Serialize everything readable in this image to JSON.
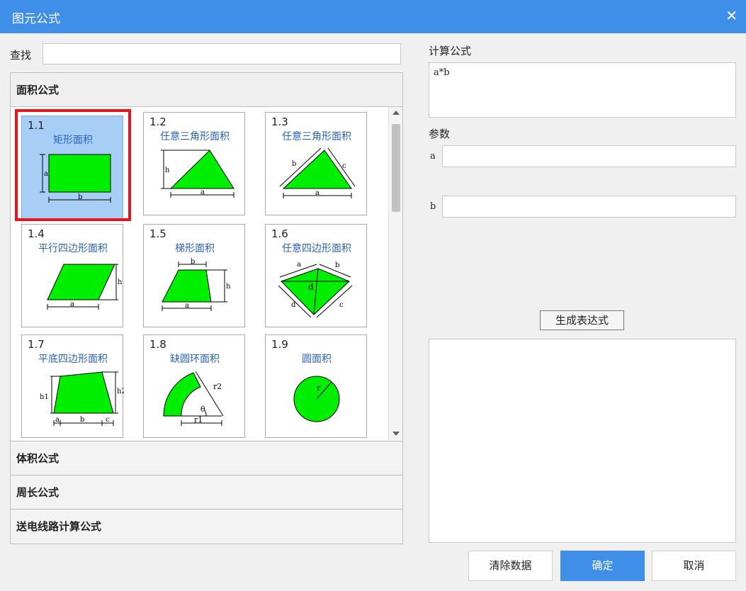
{
  "window": {
    "title": "图元公式"
  },
  "search": {
    "label": "查找",
    "value": ""
  },
  "groups": [
    {
      "label": "面积公式"
    },
    {
      "label": "体积公式"
    },
    {
      "label": "周长公式"
    },
    {
      "label": "送电线路计算公式"
    }
  ],
  "items": [
    {
      "num": "1.1",
      "name": "矩形面积",
      "labels": [
        "a",
        "b"
      ]
    },
    {
      "num": "1.2",
      "name": "任意三角形面积",
      "labels": [
        "h",
        "a"
      ]
    },
    {
      "num": "1.3",
      "name": "任意三角形面积",
      "labels": [
        "b",
        "c",
        "a"
      ]
    },
    {
      "num": "1.4",
      "name": "平行四边形面积",
      "labels": [
        "h",
        "a"
      ]
    },
    {
      "num": "1.5",
      "name": "梯形面积",
      "labels": [
        "b",
        "h",
        "a"
      ]
    },
    {
      "num": "1.6",
      "name": "任意四边形面积",
      "labels": [
        "a",
        "b",
        "d",
        "d",
        "c"
      ]
    },
    {
      "num": "1.7",
      "name": "平底四边形面积",
      "labels": [
        "h1",
        "h2",
        "a",
        "b",
        "c"
      ]
    },
    {
      "num": "1.8",
      "name": "缺圆环面积",
      "labels": [
        "r2",
        "θ",
        "r1"
      ]
    },
    {
      "num": "1.9",
      "name": "圆面积",
      "labels": [
        "r"
      ]
    }
  ],
  "formula": {
    "label": "计算公式",
    "value": "a*b"
  },
  "params": {
    "label": "参数",
    "list": [
      {
        "name": "a",
        "value": ""
      },
      {
        "name": "b",
        "value": ""
      }
    ]
  },
  "buttons": {
    "generate": "生成表达式",
    "clear": "清除数据",
    "ok": "确定",
    "cancel": "取消"
  },
  "colors": {
    "titlebar": "#3f8ee8",
    "shape_fill": "#00ee00",
    "selected_bg": "#a7cff5",
    "selected_outline": "#e8141e",
    "item_name": "#2a62b8"
  }
}
